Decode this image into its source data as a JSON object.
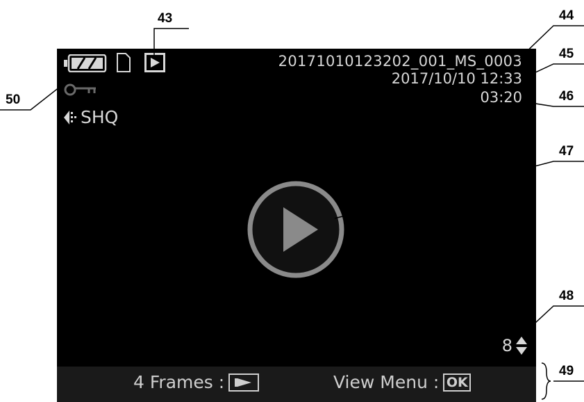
{
  "screen": {
    "file_name": "20171010123202_001_MS_0003",
    "date_time": "2017/10/10 12:33",
    "duration": "03:20",
    "quality": "SHQ",
    "frame_count": "8",
    "bottom_bar": {
      "frames_label": "4 Frames :",
      "view_menu_label": "View Menu :",
      "ok_key": "OK"
    }
  },
  "callouts": {
    "c43": "43",
    "c44": "44",
    "c45": "45",
    "c46": "46",
    "c47": "47",
    "c48": "48",
    "c49": "49",
    "c50": "50"
  },
  "icons": {
    "battery": "battery-icon",
    "card": "memory-card-icon",
    "playback_mode": "playback-mode-icon",
    "protect": "key-icon",
    "quality": "audio-quality-icon",
    "play": "play-icon",
    "scroll": "up-down-arrow-icon"
  },
  "colors": {
    "screen_bg": "#000000",
    "osd_text": "#d8d8d8",
    "bar_bg": "#1a1a1a"
  }
}
